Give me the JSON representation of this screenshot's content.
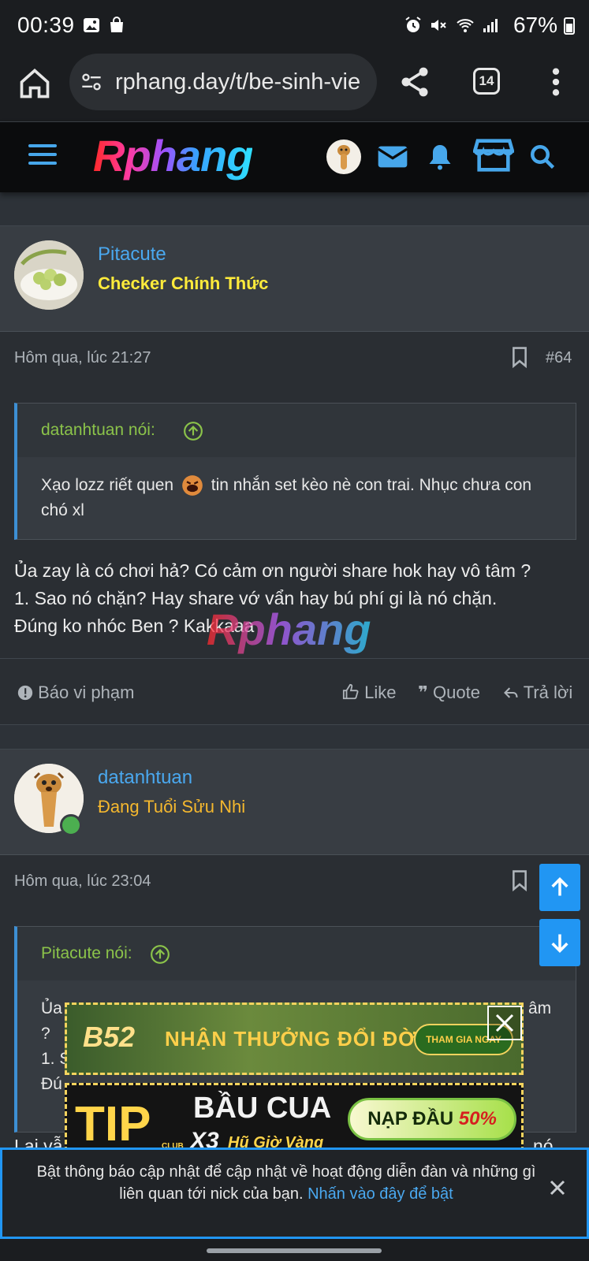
{
  "status_bar": {
    "time": "00:39",
    "battery": "67%"
  },
  "browser": {
    "url": "rphang.day/t/be-sinh-vie",
    "tab_count": "14"
  },
  "site": {
    "logo": "Rphang",
    "accent_color": "#47a7eb"
  },
  "posts": [
    {
      "username": "Pitacute",
      "user_title": "Checker Chính Thức",
      "user_title_color": "#ffeb3b",
      "date": "Hôm qua, lúc 21:27",
      "post_number": "#64",
      "quote": {
        "author": "datanhtuan nói:",
        "text_before": "Xạo lozz riết quen",
        "text_after": "tin nhắn set kèo nè con trai. Nhục chưa con chó xl"
      },
      "lines": [
        "Ủa zay là có chơi hả? Có cảm ơn người share hok hay vô tâm ?",
        "1. Sao nó chặn? Hay share vớ vẩn hay bú phí gi là nó chặn.",
        "Đúng ko nhóc Ben ? Kakkaaa"
      ],
      "actions": {
        "report": "Báo vi phạm",
        "like": "Like",
        "quote": "Quote",
        "reply": "Trả lời"
      }
    },
    {
      "username": "datanhtuan",
      "user_title": "Đang Tuổi Sửu Nhi",
      "user_title_color": "#f5b82e",
      "date": "Hôm qua, lúc 23:04",
      "quote": {
        "author": "Pitacute nói:",
        "lines": [
          "Ủa",
          "?",
          "1. S",
          "Đú"
        ],
        "line1_tail": "âm"
      },
      "partial_text_left": "Lai vẫ",
      "partial_text_right": "nó"
    }
  ],
  "ads": {
    "ad1": {
      "brand": "B52",
      "headline": "NHẬN THƯỞNG ĐỔI ĐỜI",
      "button": "THAM GIA NGAY"
    },
    "ad2": {
      "brand": "TIP",
      "club": "CLUB",
      "title": "BẦU CUA",
      "x3": "X3",
      "subtitle": "Hũ Giờ Vàng",
      "promo": "NẠP ĐẦU",
      "promo_pct": "50%"
    }
  },
  "notification": {
    "text": "Bật thông báo cập nhật để cập nhật về hoạt động diễn đàn và những gì liên quan tới nick của bạn.",
    "link": "Nhấn vào đây để bật"
  },
  "watermark": "Rphang"
}
